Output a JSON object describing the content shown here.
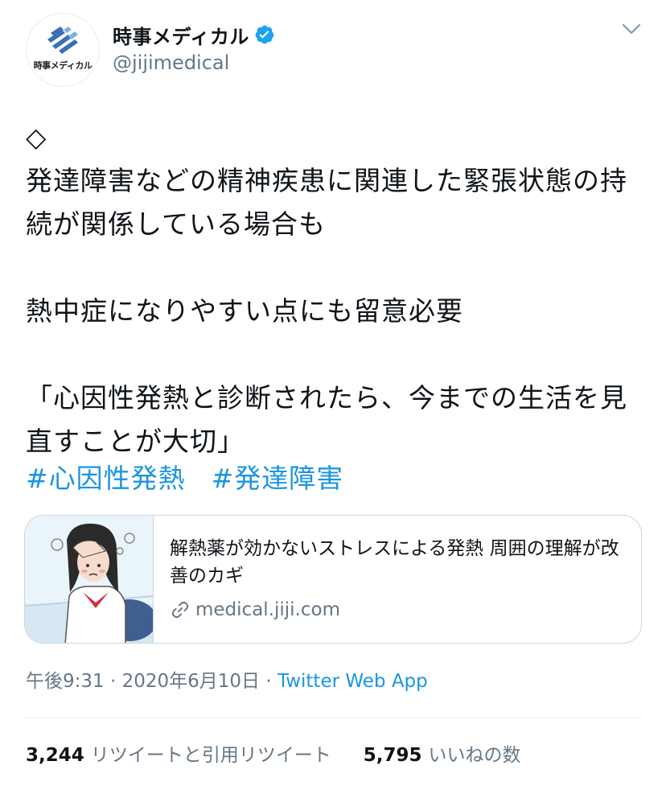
{
  "account": {
    "display_name": "時事メディカル",
    "handle": "@jijimedical",
    "avatar_text": "時事メディカル",
    "verified": true
  },
  "tweet": {
    "text": "◇\n発達障害などの精神疾患に関連した緊張状態の持続が関係している場合も\n\n熱中症になりやすい点にも留意必要\n\n「心因性発熱と診断されたら、今までの生活を見直すことが大切」",
    "hashtags": [
      "#心因性発熱",
      "#発達障害"
    ]
  },
  "card": {
    "title": "解熱薬が効かないストレスによる発熱 周囲の理解が改善のカギ",
    "domain": "medical.jiji.com"
  },
  "meta": {
    "time": "午後9:31",
    "separator1": " · ",
    "date": "2020年6月10日",
    "separator2": " · ",
    "source": "Twitter Web App"
  },
  "stats": {
    "retweets_count": "3,244",
    "retweets_label": "リツイートと引用リツイート",
    "likes_count": "5,795",
    "likes_label": "いいねの数"
  },
  "colors": {
    "link_blue": "#1b95e0",
    "verified_blue": "#1da1f2",
    "muted_gray": "#657786",
    "text_dark": "#0f1419",
    "border": "#ccd6dd"
  }
}
